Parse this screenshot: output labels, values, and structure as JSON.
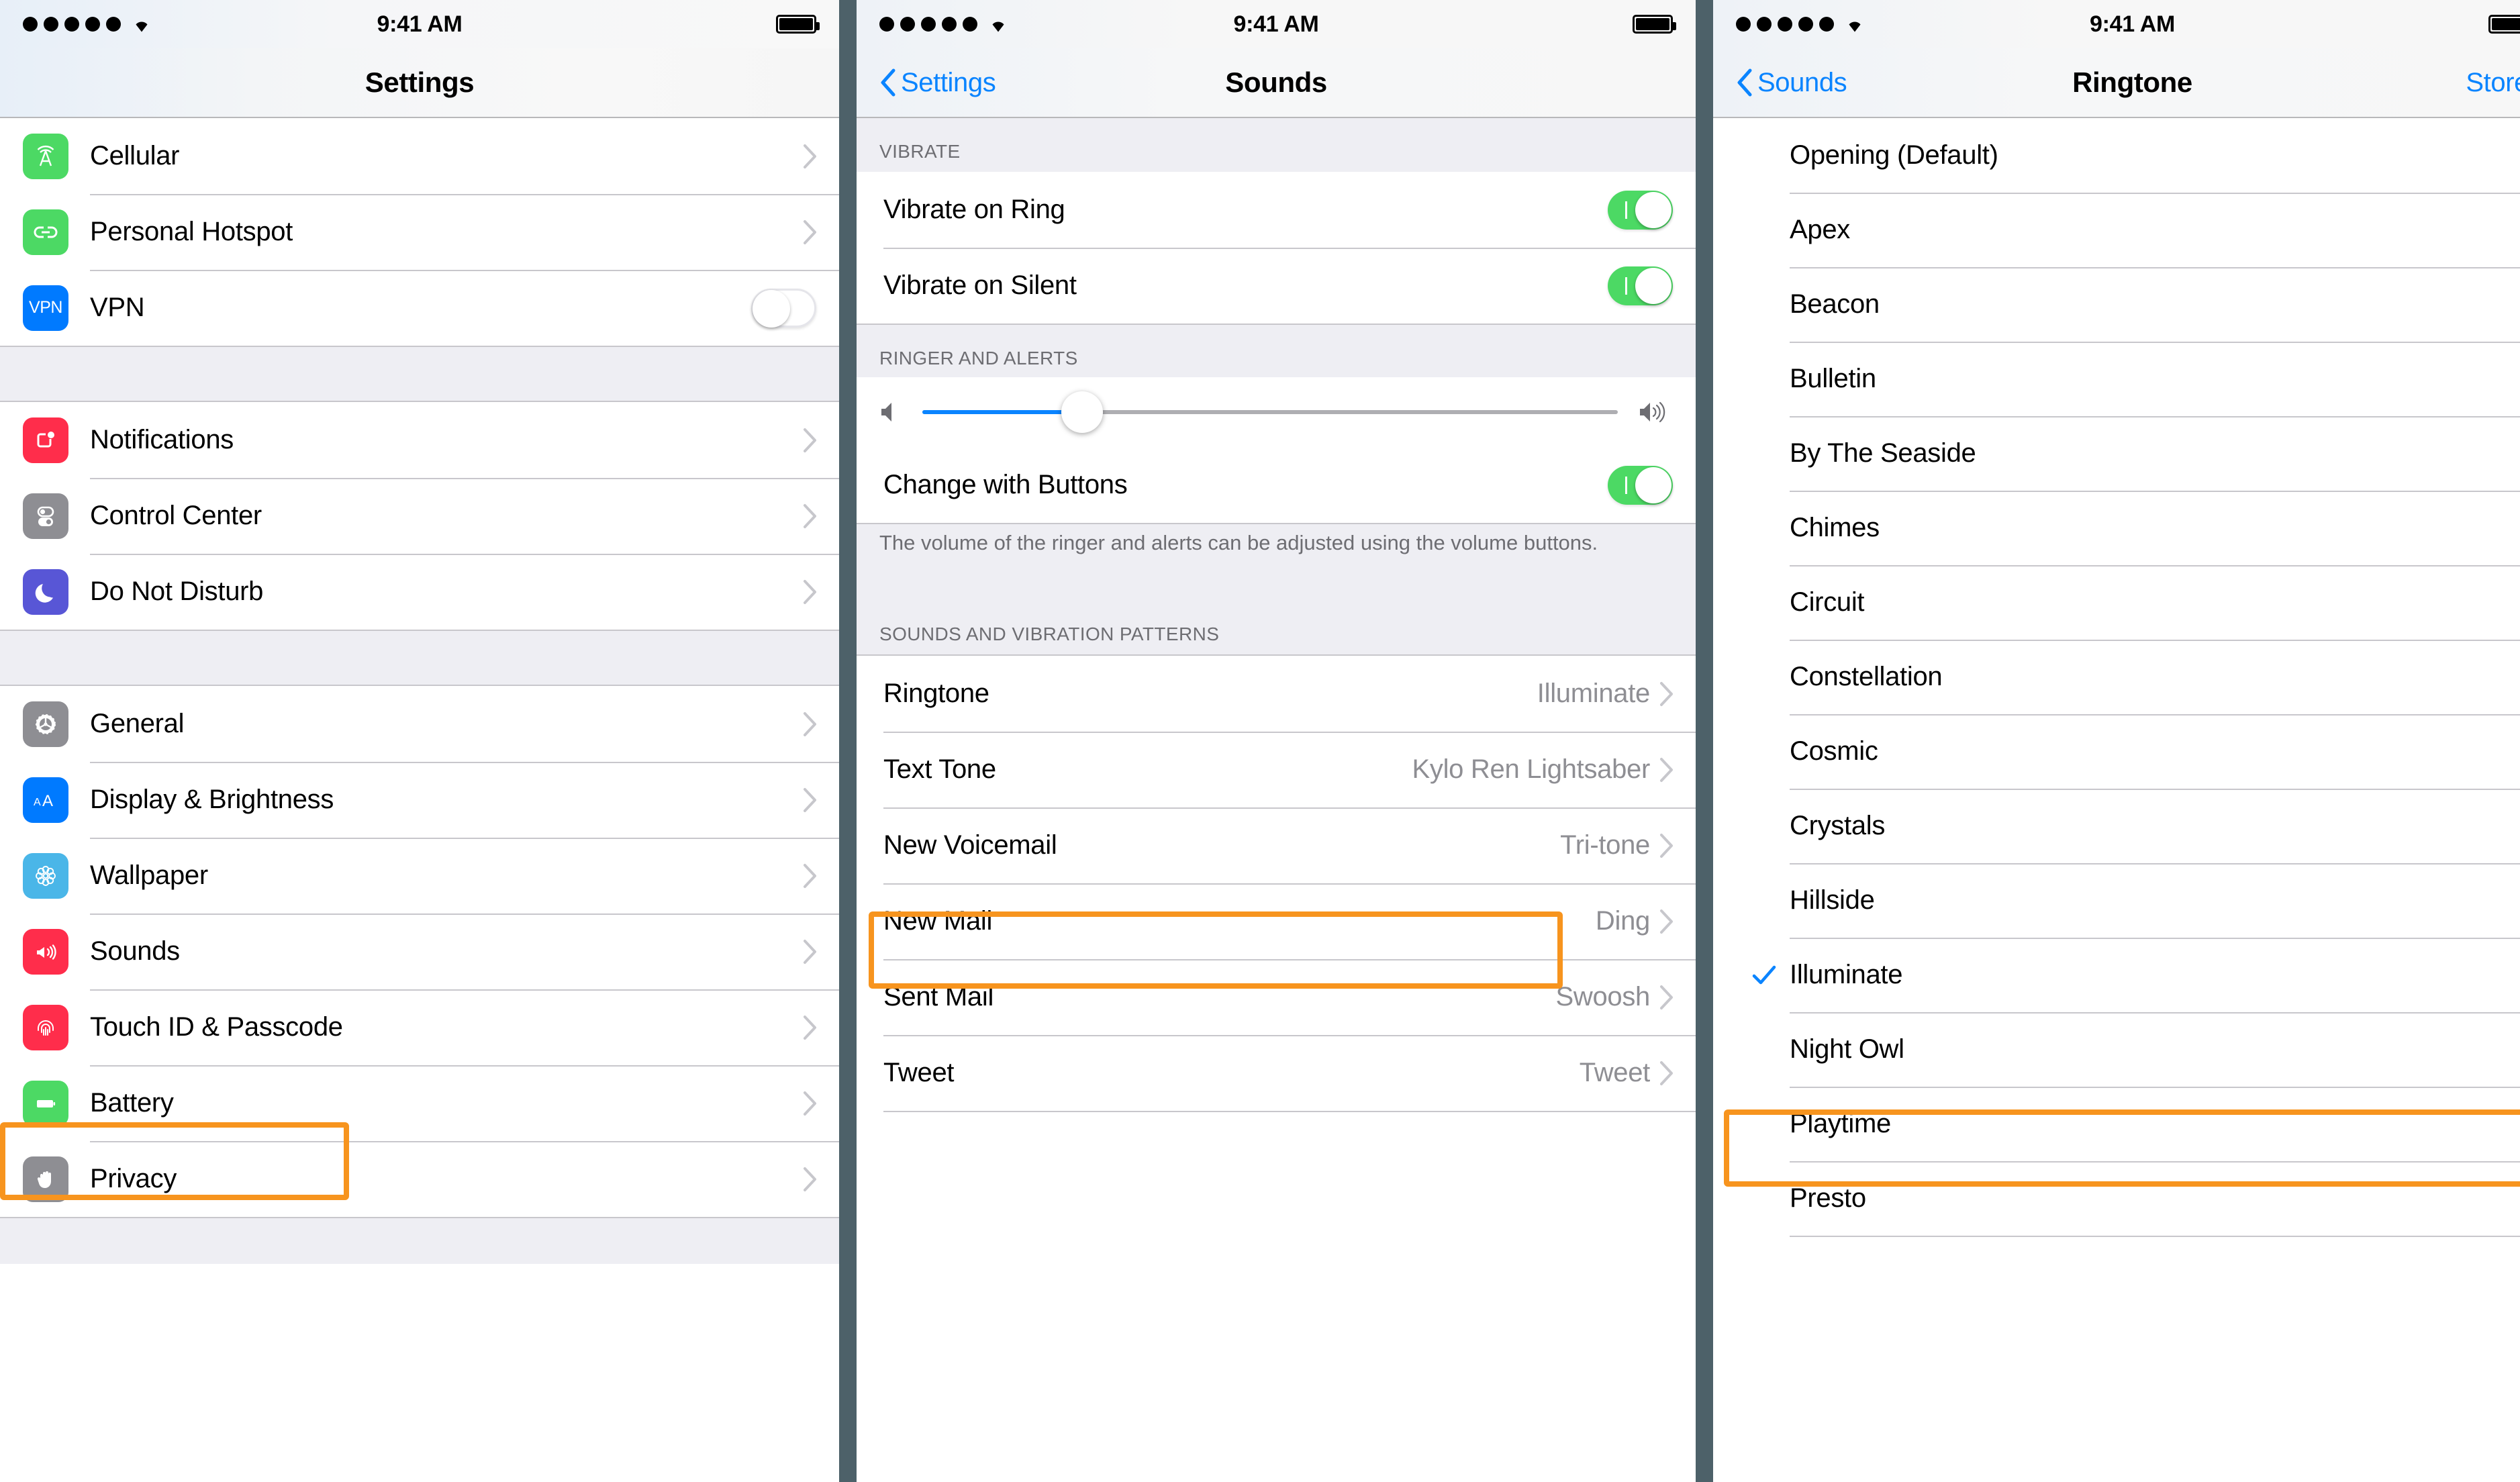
{
  "colors": {
    "accent_blue": "#0a84ff",
    "highlight_orange": "#f7941e",
    "toggle_green": "#4cd964",
    "separator": "#c8c7cc",
    "group_bg": "#eeeef3",
    "panel_divider": "#4d6169",
    "secondary_text": "#8e8e93"
  },
  "status_bar": {
    "time": "9:41 AM",
    "signal_dots": 5,
    "wifi": "wifi-icon",
    "battery": "battery-full-icon"
  },
  "settings_screen": {
    "title": "Settings",
    "groups": [
      {
        "items": [
          {
            "label": "Cellular",
            "icon": "cellular-icon",
            "icon_color": "#4cd964",
            "accessory": "chevron"
          },
          {
            "label": "Personal Hotspot",
            "icon": "hotspot-link-icon",
            "icon_color": "#4cd964",
            "accessory": "chevron"
          },
          {
            "label": "VPN",
            "icon": "vpn-icon",
            "icon_color": "#007aff",
            "icon_text": "VPN",
            "accessory": "toggle-off"
          }
        ]
      },
      {
        "items": [
          {
            "label": "Notifications",
            "icon": "notifications-icon",
            "icon_color": "#ff2d4b",
            "accessory": "chevron"
          },
          {
            "label": "Control Center",
            "icon": "control-center-icon",
            "icon_color": "#8e8e93",
            "accessory": "chevron"
          },
          {
            "label": "Do Not Disturb",
            "icon": "moon-icon",
            "icon_color": "#5856d6",
            "accessory": "chevron"
          }
        ]
      },
      {
        "items": [
          {
            "label": "General",
            "icon": "gear-icon",
            "icon_color": "#8e8e93",
            "accessory": "chevron"
          },
          {
            "label": "Display & Brightness",
            "icon": "display-brightness-icon",
            "icon_color": "#007aff",
            "icon_text": "AA",
            "accessory": "chevron"
          },
          {
            "label": "Wallpaper",
            "icon": "wallpaper-flower-icon",
            "icon_color": "#4ab6e8",
            "accessory": "chevron"
          },
          {
            "label": "Sounds",
            "icon": "speaker-icon",
            "icon_color": "#ff2d4b",
            "accessory": "chevron",
            "highlighted": true
          },
          {
            "label": "Touch ID & Passcode",
            "icon": "fingerprint-icon",
            "icon_color": "#ff2d4b",
            "accessory": "chevron"
          },
          {
            "label": "Battery",
            "icon": "battery-icon",
            "icon_color": "#4cd964",
            "accessory": "chevron"
          },
          {
            "label": "Privacy",
            "icon": "hand-icon",
            "icon_color": "#8e8e93",
            "accessory": "chevron"
          }
        ]
      }
    ]
  },
  "sounds_screen": {
    "back_label": "Settings",
    "title": "Sounds",
    "sections": [
      {
        "header": "VIBRATE",
        "rows": [
          {
            "label": "Vibrate on Ring",
            "toggle": "on"
          },
          {
            "label": "Vibrate on Silent",
            "toggle": "on"
          }
        ]
      },
      {
        "header": "RINGER AND ALERTS",
        "slider": {
          "left_icon": "speaker-low-icon",
          "right_icon": "speaker-high-icon",
          "value_percent": 23
        },
        "rows": [
          {
            "label": "Change with Buttons",
            "toggle": "on"
          }
        ],
        "footer": "The volume of the ringer and alerts can be adjusted using the volume buttons."
      },
      {
        "header": "SOUNDS AND VIBRATION PATTERNS",
        "rows": [
          {
            "label": "Ringtone",
            "value": "Illuminate",
            "accessory": "chevron",
            "highlighted": true
          },
          {
            "label": "Text Tone",
            "value": "Kylo Ren Lightsaber",
            "accessory": "chevron"
          },
          {
            "label": "New Voicemail",
            "value": "Tri-tone",
            "accessory": "chevron"
          },
          {
            "label": "New Mail",
            "value": "Ding",
            "accessory": "chevron"
          },
          {
            "label": "Sent Mail",
            "value": "Swoosh",
            "accessory": "chevron"
          },
          {
            "label": "Tweet",
            "value": "Tweet",
            "accessory": "chevron"
          }
        ]
      }
    ]
  },
  "ringtone_screen": {
    "back_label": "Sounds",
    "title": "Ringtone",
    "right_action": "Store",
    "items": [
      {
        "label": "Opening (Default)",
        "selected": false
      },
      {
        "label": "Apex",
        "selected": false
      },
      {
        "label": "Beacon",
        "selected": false
      },
      {
        "label": "Bulletin",
        "selected": false
      },
      {
        "label": "By The Seaside",
        "selected": false
      },
      {
        "label": "Chimes",
        "selected": false
      },
      {
        "label": "Circuit",
        "selected": false
      },
      {
        "label": "Constellation",
        "selected": false
      },
      {
        "label": "Cosmic",
        "selected": false
      },
      {
        "label": "Crystals",
        "selected": false
      },
      {
        "label": "Hillside",
        "selected": false
      },
      {
        "label": "Illuminate",
        "selected": true,
        "highlighted": true
      },
      {
        "label": "Night Owl",
        "selected": false
      },
      {
        "label": "Playtime",
        "selected": false
      },
      {
        "label": "Presto",
        "selected": false
      }
    ]
  }
}
